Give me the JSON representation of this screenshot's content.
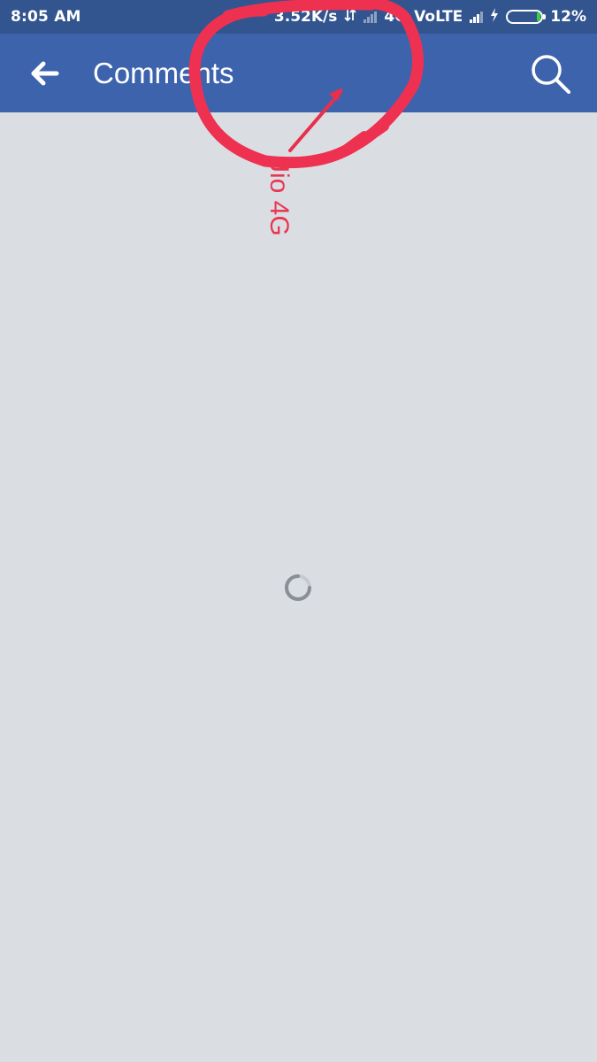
{
  "status_bar": {
    "time": "8:05 AM",
    "network_speed": "3.52K/s",
    "network_type": "4G",
    "volte": "VoLTE",
    "battery_percent": "12%",
    "battery_level": 0.12,
    "icons": [
      "data-transfer-icon",
      "signal-bars-icon",
      "signal-bars-icon",
      "charging-bolt-icon",
      "battery-icon"
    ]
  },
  "app_bar": {
    "title": "Comments",
    "back_icon": "arrow-left-icon",
    "search_icon": "search-icon"
  },
  "content": {
    "loading_icon": "loading-spinner-icon"
  },
  "annotation": {
    "text": "Jio 4G",
    "color": "#ea3553"
  },
  "colors": {
    "status_bar": "#33558f",
    "app_bar": "#3d63ad",
    "background": "#dadee2",
    "battery_fill": "#3ad13a"
  }
}
